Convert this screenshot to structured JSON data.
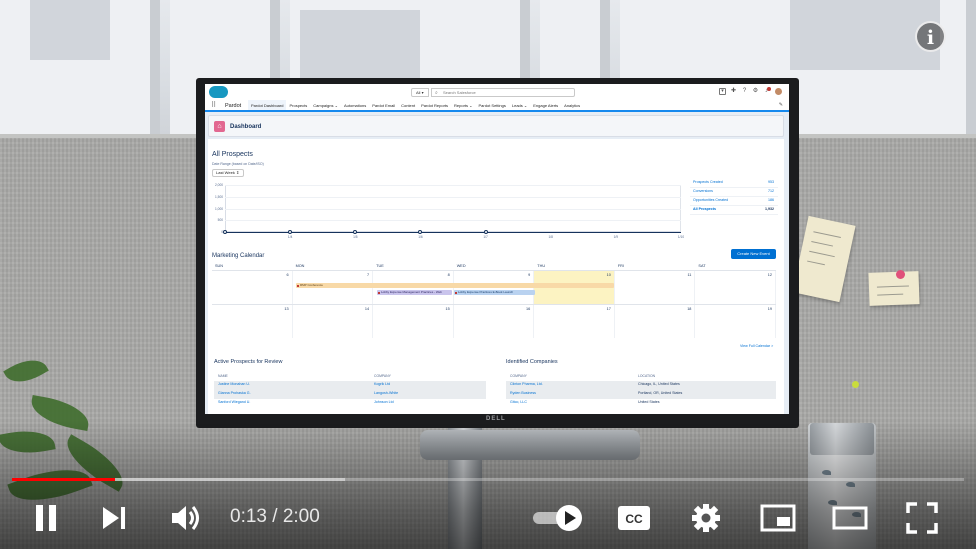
{
  "video": {
    "time_current": "0:13",
    "time_separator": " / ",
    "time_total": "2:00",
    "progress_fraction": 0.108,
    "loaded_fraction": 0.35,
    "colors": {
      "played": "#ff0000",
      "controls": "#ffffff"
    },
    "icons": [
      "info-icon",
      "pause-icon",
      "next-icon",
      "volume-icon",
      "autoplay-toggle-icon",
      "captions-icon",
      "settings-icon",
      "miniplayer-icon",
      "theater-icon",
      "fullscreen-icon"
    ]
  },
  "monitor": {
    "brand": "DELL"
  },
  "salesforce": {
    "app_name": "Pardot",
    "search": {
      "scope": "All",
      "placeholder": "Search Salesforce"
    },
    "nav": [
      "Pardot Dashboard",
      "Prospects",
      "Campaigns",
      "Automations",
      "Pardot Email",
      "Content",
      "Pardot Reports",
      "Reports",
      "Pardot Settings",
      "Leads",
      "Engage Alerts",
      "Analytics"
    ],
    "nav_active": "Pardot Dashboard",
    "page_title": "Dashboard",
    "all_prospects": {
      "title": "All Prospects",
      "range_label": "Date Range (based on Date/ISO)",
      "range_value": "Last Week"
    },
    "stats": [
      {
        "label": "Prospects Created",
        "value": "953"
      },
      {
        "label": "Conversions",
        "value": "712"
      },
      {
        "label": "Opportunities Created",
        "value": "186"
      },
      {
        "label": "All Prospects",
        "value": "1,932"
      }
    ],
    "calendar": {
      "title": "Marketing Calendar",
      "new_event": "Create New Event",
      "days": [
        "SUN",
        "MON",
        "TUE",
        "WED",
        "THU",
        "FRI",
        "SAT"
      ],
      "week1": [
        "",
        "6",
        "7",
        "8",
        "9",
        "10",
        "11",
        "12"
      ],
      "week2": [
        "",
        "13",
        "14",
        "15",
        "16",
        "17",
        "18",
        "19"
      ],
      "events": [
        "RMP Conference",
        "Lobby Expense Management Practices - Web",
        "Lobby Expense Practices E-Book Launch"
      ],
      "view_full": "View Full Calendar >"
    },
    "active_prospects": {
      "title": "Active Prospects for Review",
      "columns": [
        "NAME",
        "COMPANY"
      ],
      "rows": [
        [
          "Justine Monahan U.",
          "Kogrik Ltd"
        ],
        [
          "Gianna Prohaska G.",
          "Langosh-White"
        ],
        [
          "Sanford Wiegand U.",
          "Johnson Ltd"
        ]
      ]
    },
    "identified_companies": {
      "title": "Identified Companies",
      "columns": [
        "COMPANY",
        "LOCATION"
      ],
      "rows": [
        [
          "Clinton Pharma, Ltd.",
          "Chicago, IL, United States"
        ],
        [
          "Ryden Business",
          "Portland, OR, United States"
        ],
        [
          "Gitco, LLC",
          "United States"
        ]
      ]
    }
  },
  "chart_data": {
    "type": "line",
    "title": "All Prospects",
    "x": [
      "1/4",
      "1/5",
      "1/6",
      "1/7",
      "1/8",
      "1/9",
      "1/10"
    ],
    "y_ticks": [
      "2,000",
      "1,500",
      "1,000",
      "500",
      "0"
    ],
    "series": [
      {
        "values": [
          0,
          0,
          0,
          0,
          0,
          0,
          0
        ]
      }
    ],
    "ylim": [
      0,
      2000
    ]
  }
}
